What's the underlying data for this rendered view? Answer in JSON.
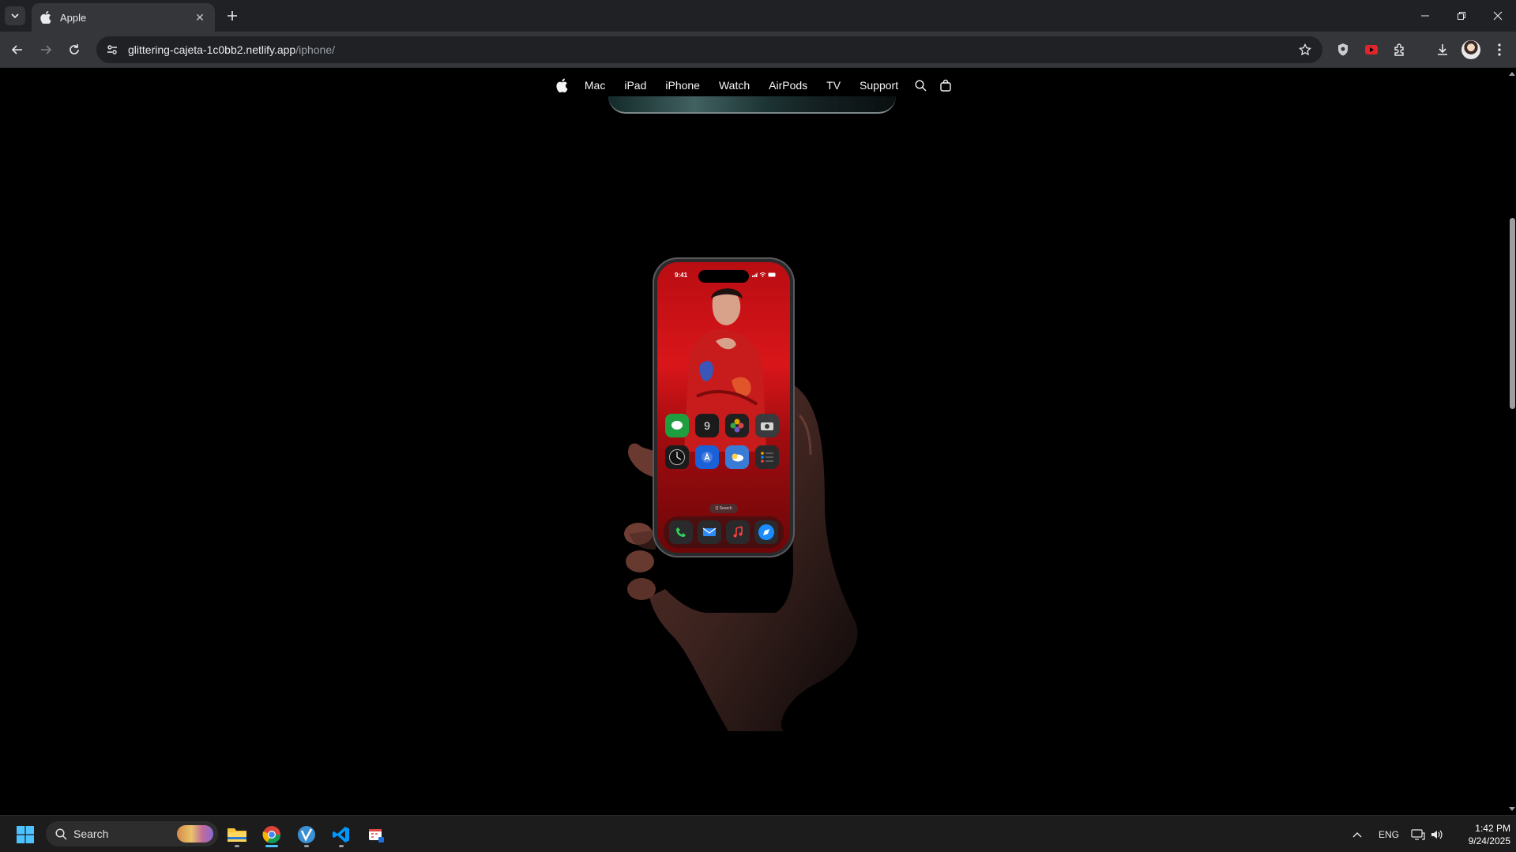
{
  "browser": {
    "tab": {
      "title": "Apple"
    },
    "address": {
      "host": "glittering-cajeta-1c0bb2.netlify.app",
      "path": "/iphone/"
    }
  },
  "globalnav": {
    "items": [
      {
        "label": "Mac"
      },
      {
        "label": "iPad"
      },
      {
        "label": "iPhone"
      },
      {
        "label": "Watch"
      },
      {
        "label": "AirPods"
      },
      {
        "label": "TV"
      },
      {
        "label": "Support"
      }
    ]
  },
  "hero": {
    "phone": {
      "status_time": "9:41",
      "calendar_day": "9",
      "search_pill": "Q Search"
    }
  },
  "taskbar": {
    "search_label": "Search",
    "language": "ENG",
    "time": "1:42 PM",
    "date": "9/24/2025"
  },
  "colors": {
    "page_bg": "#000000",
    "chrome_dark": "#202124",
    "chrome_mid": "#35363a",
    "nav_text": "#f5f5f7",
    "phone_red": "#d9161a"
  }
}
